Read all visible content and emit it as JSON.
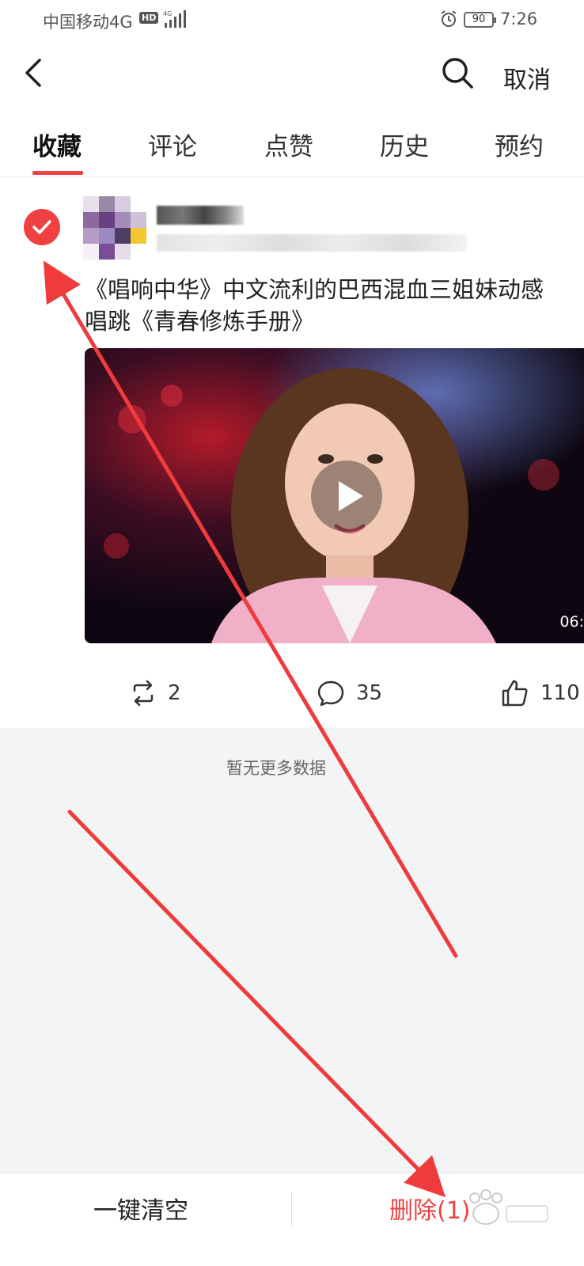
{
  "status_bar": {
    "carrier": "中国移动4G",
    "hd_badge": "HD",
    "battery": "90",
    "time": "7:26"
  },
  "nav": {
    "cancel_label": "取消"
  },
  "tabs": [
    {
      "label": "收藏",
      "active": true
    },
    {
      "label": "评论",
      "active": false
    },
    {
      "label": "点赞",
      "active": false
    },
    {
      "label": "历史",
      "active": false
    },
    {
      "label": "预约",
      "active": false
    }
  ],
  "card": {
    "selected": true,
    "title_line1": "《唱响中华》中文流利的巴西混血三姐妹动感",
    "title_line2": "唱跳《青春修炼手册》",
    "duration": "06:",
    "reposts": "2",
    "comments": "35",
    "likes": "110"
  },
  "empty_text": "暂无更多数据",
  "bottom": {
    "clear_all_label": "一键清空",
    "delete_label": "删除(1)"
  },
  "colors": {
    "accent": "#f04142",
    "annotation_arrow": "#ef3b3b"
  }
}
